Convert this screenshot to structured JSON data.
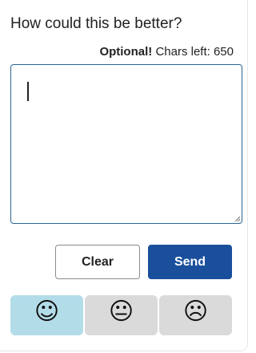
{
  "feedback": {
    "title": "How could this be better?",
    "optional_label": "Optional!",
    "chars_left_label": "Chars left: 650",
    "comment_value": ""
  },
  "buttons": {
    "clear_label": "Clear",
    "send_label": "Send"
  },
  "ratings": [
    {
      "glyph": "☺",
      "icon": "happy-face-icon",
      "selected": true
    },
    {
      "glyph": "😐",
      "icon": "neutral-face-icon",
      "selected": false
    },
    {
      "glyph": "☹",
      "icon": "sad-face-icon",
      "selected": false
    }
  ],
  "colors": {
    "send_button": "#1a4f9c",
    "selected_rating": "#b3dce9",
    "rating_background": "#dadada",
    "textarea_border": "#2a6496"
  }
}
